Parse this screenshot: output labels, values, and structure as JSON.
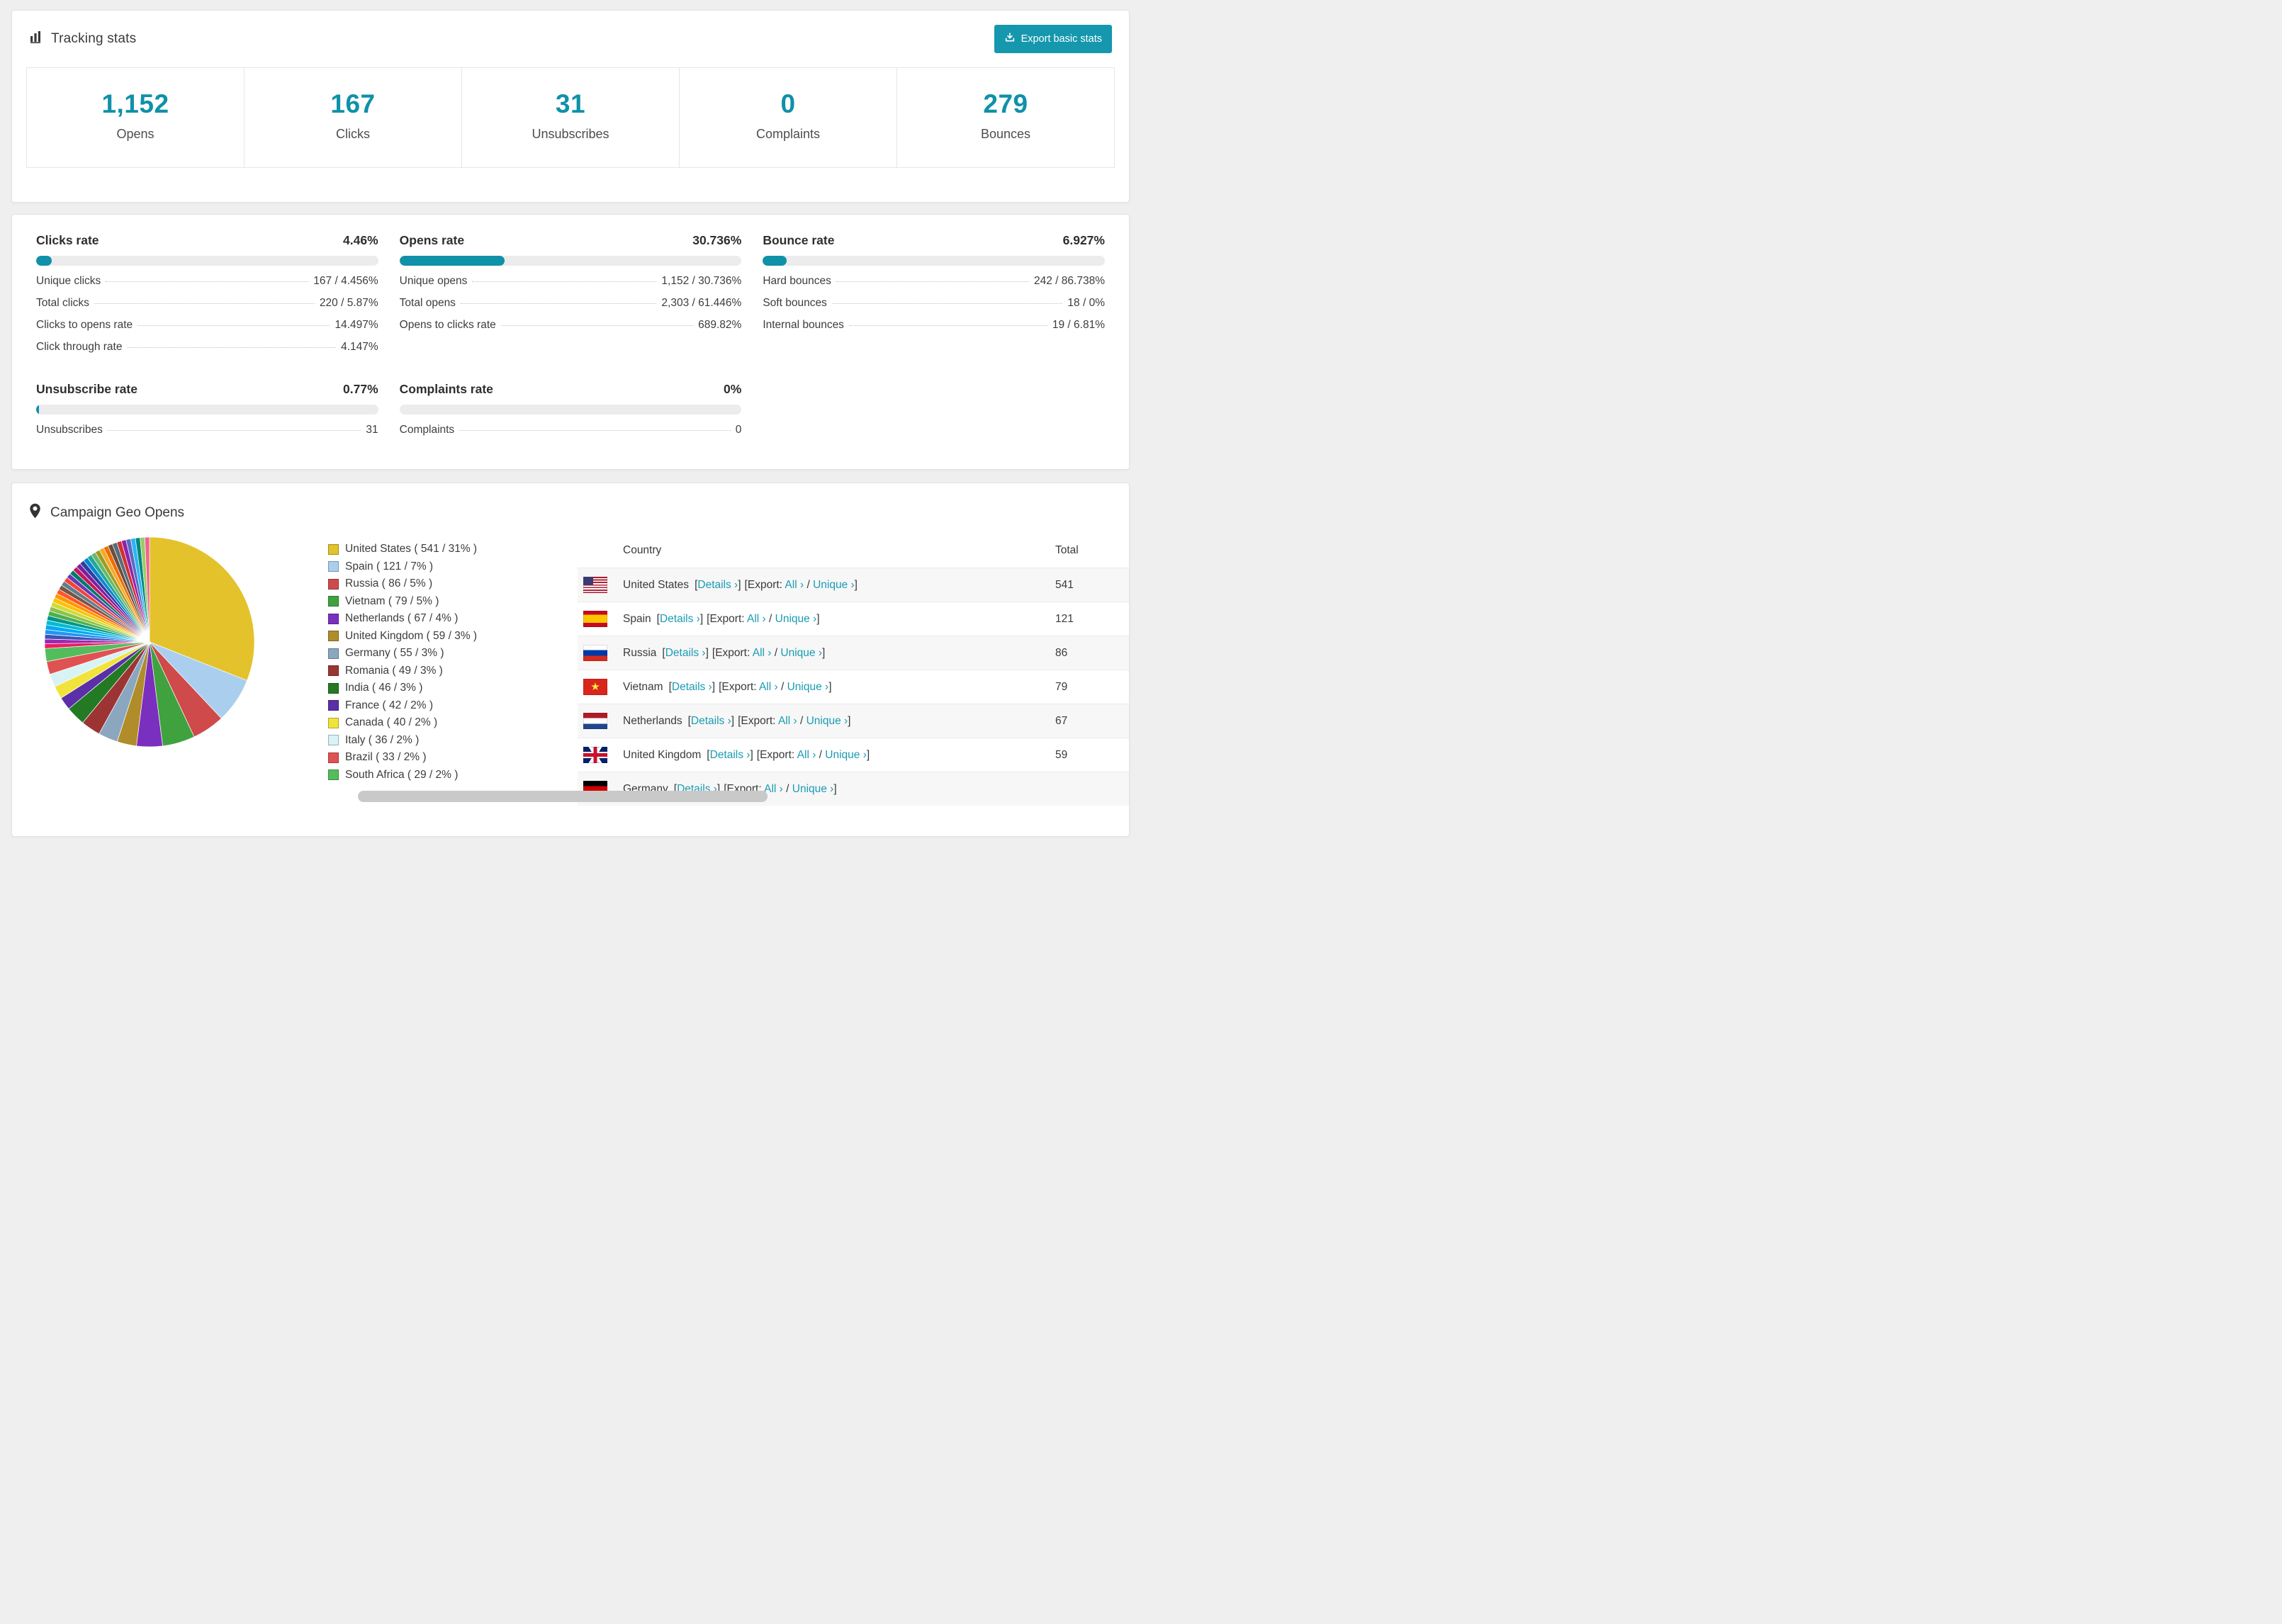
{
  "tracking": {
    "title": "Tracking stats",
    "export_button": "Export basic stats",
    "stats": [
      {
        "value": "1,152",
        "label": "Opens"
      },
      {
        "value": "167",
        "label": "Clicks"
      },
      {
        "value": "31",
        "label": "Unsubscribes"
      },
      {
        "value": "0",
        "label": "Complaints"
      },
      {
        "value": "279",
        "label": "Bounces"
      }
    ]
  },
  "rates": {
    "clicks": {
      "title": "Clicks rate",
      "pct_label": "4.46%",
      "pct": 4.46,
      "rows": [
        {
          "label": "Unique clicks",
          "value": "167 / 4.456%"
        },
        {
          "label": "Total clicks",
          "value": "220 / 5.87%"
        },
        {
          "label": "Clicks to opens rate",
          "value": "14.497%"
        },
        {
          "label": "Click through rate",
          "value": "4.147%"
        }
      ]
    },
    "opens": {
      "title": "Opens rate",
      "pct_label": "30.736%",
      "pct": 30.736,
      "rows": [
        {
          "label": "Unique opens",
          "value": "1,152 / 30.736%"
        },
        {
          "label": "Total opens",
          "value": "2,303 / 61.446%"
        },
        {
          "label": "Opens to clicks rate",
          "value": "689.82%"
        }
      ]
    },
    "bounce": {
      "title": "Bounce rate",
      "pct_label": "6.927%",
      "pct": 6.927,
      "rows": [
        {
          "label": "Hard bounces",
          "value": "242 / 86.738%"
        },
        {
          "label": "Soft bounces",
          "value": "18 / 0%"
        },
        {
          "label": "Internal bounces",
          "value": "19 / 6.81%"
        }
      ]
    },
    "unsubscribe": {
      "title": "Unsubscribe rate",
      "pct_label": "0.77%",
      "pct": 0.77,
      "rows": [
        {
          "label": "Unsubscribes",
          "value": "31"
        }
      ]
    },
    "complaints": {
      "title": "Complaints rate",
      "pct_label": "0%",
      "pct": 0,
      "rows": [
        {
          "label": "Complaints",
          "value": "0"
        }
      ]
    }
  },
  "geo": {
    "title": "Campaign Geo Opens",
    "labels": {
      "open_bracket": "[",
      "close_bracket": "]",
      "details": "Details ›",
      "export": "Export:",
      "all": "All ›",
      "slash": "/",
      "unique": "Unique ›"
    },
    "table": {
      "headers": [
        "Country",
        "Total"
      ],
      "rows": [
        {
          "country": "United States",
          "flag": "us",
          "total": "541"
        },
        {
          "country": "Spain",
          "flag": "es",
          "total": "121"
        },
        {
          "country": "Russia",
          "flag": "ru",
          "total": "86"
        },
        {
          "country": "Vietnam",
          "flag": "vn",
          "total": "79"
        },
        {
          "country": "Netherlands",
          "flag": "nl",
          "total": "67"
        },
        {
          "country": "United Kingdom",
          "flag": "gb",
          "total": "59"
        },
        {
          "country": "Germany",
          "flag": "de",
          "total": ""
        }
      ]
    }
  },
  "chart_data": {
    "type": "pie",
    "title": "Campaign Geo Opens",
    "legend_position": "right",
    "slices": [
      {
        "label": "United States",
        "value": 541,
        "pct": 31,
        "color": "#e3c22c",
        "legend": "United States ( 541 / 31% )"
      },
      {
        "label": "Spain",
        "value": 121,
        "pct": 7,
        "color": "#aacfee",
        "legend": "Spain ( 121 / 7% )"
      },
      {
        "label": "Russia",
        "value": 86,
        "pct": 5,
        "color": "#cf4a4a",
        "legend": "Russia ( 86 / 5% )"
      },
      {
        "label": "Vietnam",
        "value": 79,
        "pct": 5,
        "color": "#3fa23f",
        "legend": "Vietnam ( 79 / 5% )"
      },
      {
        "label": "Netherlands",
        "value": 67,
        "pct": 4,
        "color": "#7b2fbe",
        "legend": "Netherlands ( 67 / 4% )"
      },
      {
        "label": "United Kingdom",
        "value": 59,
        "pct": 3,
        "color": "#b08c2a",
        "legend": "United Kingdom ( 59 / 3% )"
      },
      {
        "label": "Germany",
        "value": 55,
        "pct": 3,
        "color": "#8ba7c0",
        "legend": "Germany ( 55 / 3% )"
      },
      {
        "label": "Romania",
        "value": 49,
        "pct": 3,
        "color": "#9c3434",
        "legend": "Romania ( 49 / 3% )"
      },
      {
        "label": "India",
        "value": 46,
        "pct": 3,
        "color": "#237a23",
        "legend": "India ( 46 / 3% )"
      },
      {
        "label": "France",
        "value": 42,
        "pct": 2,
        "color": "#5a2fa8",
        "legend": "France ( 42 / 2% )"
      },
      {
        "label": "Canada",
        "value": 40,
        "pct": 2,
        "color": "#f2e33c",
        "legend": "Canada ( 40 / 2% )"
      },
      {
        "label": "Italy",
        "value": 36,
        "pct": 2,
        "color": "#d8f3f5",
        "legend": "Italy ( 36 / 2% )"
      },
      {
        "label": "Brazil",
        "value": 33,
        "pct": 2,
        "color": "#e05252",
        "legend": "Brazil ( 33 / 2% )"
      },
      {
        "label": "South Africa",
        "value": 29,
        "pct": 2,
        "color": "#53bd5c",
        "legend": "South Africa ( 29 / 2% )"
      }
    ],
    "others": {
      "pct_total": 26,
      "colors": [
        "#e91e63",
        "#9c27b0",
        "#3f51b5",
        "#2196f3",
        "#03a9f4",
        "#00bcd4",
        "#009688",
        "#4caf50",
        "#8bc34a",
        "#cddc39",
        "#ffc107",
        "#ff9800",
        "#ff5722",
        "#795548",
        "#607d8b",
        "#f44336",
        "#673ab7",
        "#00796b",
        "#c2185b",
        "#7b1fa2",
        "#303f9f",
        "#0288d1",
        "#26a69a",
        "#66bb6a",
        "#9e9d24",
        "#f9a825",
        "#ef6c00",
        "#6d4c41",
        "#546e7a",
        "#d32f2f",
        "#8e24aa",
        "#5c6bc0",
        "#29b6f6",
        "#00897b",
        "#9ccc65",
        "#f06292"
      ]
    }
  },
  "colors": {
    "accent_teal": "#0f91a8",
    "button_teal": "#1597ad",
    "link": "#1a9cb3"
  }
}
